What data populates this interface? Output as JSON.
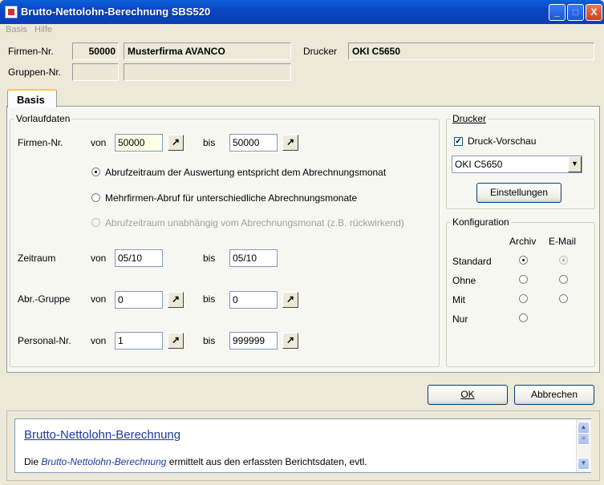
{
  "window": {
    "title": "Brutto-Nettolohn-Berechnung SBS520",
    "minimize": "_",
    "maximize": "□",
    "close": "X"
  },
  "menu": [
    "Basis",
    "Hilfe"
  ],
  "header": {
    "firmen_label": "Firmen-Nr.",
    "firmen_nr": "50000",
    "firmen_name": "Musterfirma AVANCO",
    "drucker_label": "Drucker",
    "drucker_value": "OKI C5650",
    "gruppen_label": "Gruppen-Nr.",
    "gruppen_nr": "",
    "gruppen_name": ""
  },
  "tab": {
    "label": "Basis"
  },
  "vorlauf": {
    "title": "Vorlaufdaten",
    "von": "von",
    "bis": "bis",
    "arrow": "↗",
    "firmen": {
      "label": "Firmen-Nr.",
      "von": "50000",
      "bis": "50000"
    },
    "radios": [
      {
        "label": "Abrufzeitraum der Auswertung entspricht dem Abrechnungsmonat",
        "checked": true,
        "disabled": false
      },
      {
        "label": "Mehrfirmen-Abruf für unterschiedliche Abrechnungsmonate",
        "checked": false,
        "disabled": false
      },
      {
        "label": "Abrufzeitraum unabhängig vom Abrechnungsmonat (z.B. rückwirkend)",
        "checked": false,
        "disabled": true
      }
    ],
    "zeitraum": {
      "label": "Zeitraum",
      "von": "05/10",
      "bis": "05/10"
    },
    "abr_gruppe": {
      "label": "Abr.-Gruppe",
      "von": "0",
      "bis": "0"
    },
    "personal": {
      "label": "Personal-Nr.",
      "von": "1",
      "bis": "999999"
    }
  },
  "drucker": {
    "title": "Drucker",
    "preview_label": "Druck-Vorschau",
    "preview_checked": true,
    "selected": "OKI C5650",
    "settings_button": "Einstellungen"
  },
  "konfig": {
    "title": "Konfiguration",
    "col_archiv": "Archiv",
    "col_email": "E-Mail",
    "rows": [
      {
        "label": "Standard",
        "archiv": true,
        "email": true
      },
      {
        "label": "Ohne",
        "archiv": false,
        "email": false
      },
      {
        "label": "Mit",
        "archiv": false,
        "email": false
      },
      {
        "label": "Nur",
        "archiv": false
      }
    ]
  },
  "buttons": {
    "ok": "OK",
    "cancel": "Abbrechen"
  },
  "help": {
    "title": "Brutto-Nettolohn-Berechnung",
    "text_prefix": "Die ",
    "text_emph": "Brutto-Nettolohn-Berechnung",
    "text_suffix": " ermittelt aus den erfassten Berichtsdaten, evtl."
  }
}
